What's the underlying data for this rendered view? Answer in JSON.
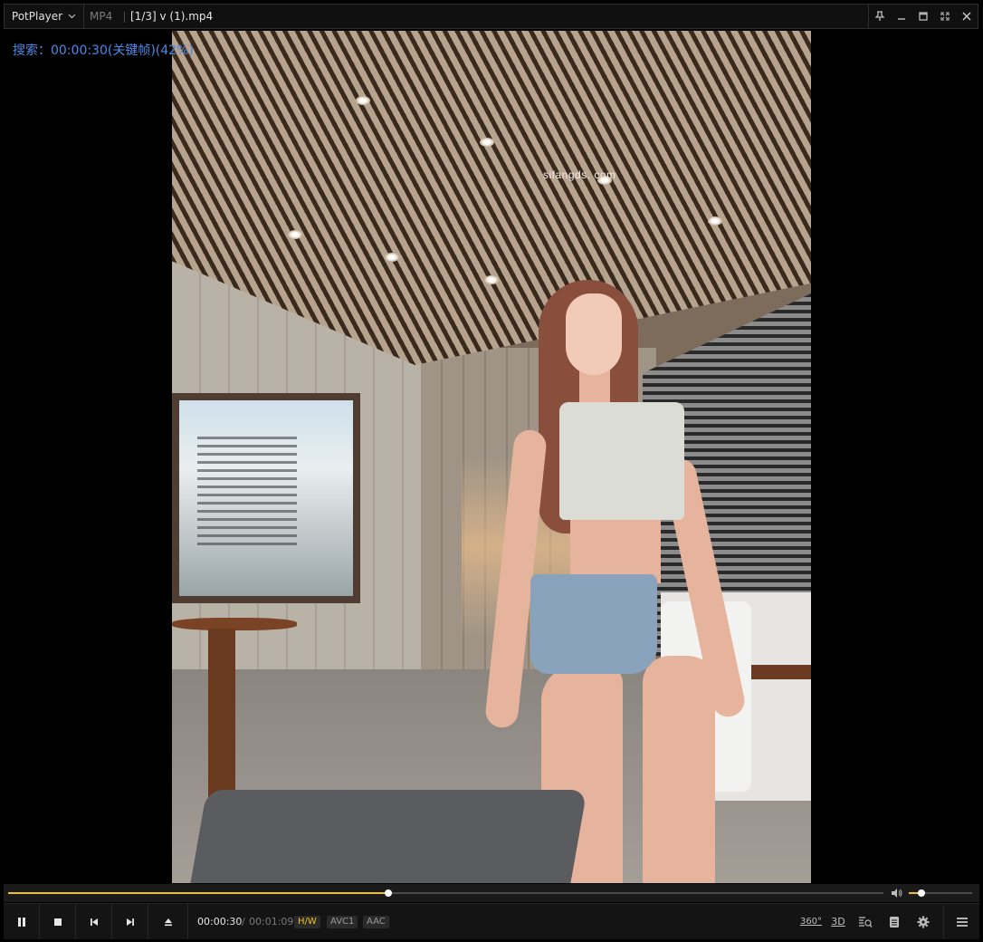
{
  "titlebar": {
    "app_name": "PotPlayer",
    "format": "MP4",
    "file_title": "[1/3] v (1).mp4"
  },
  "osd": {
    "text": "搜索：00:00:30(关键帧)(42%)"
  },
  "video": {
    "watermark": "sifangds. com"
  },
  "playback": {
    "progress_fraction": 0.4348,
    "volume_fraction": 0.2,
    "time_current": "00:00:30",
    "time_separator": "/",
    "time_total": "00:01:09"
  },
  "badges": {
    "hw": "H/W",
    "video_codec": "AVC1",
    "audio_codec": "AAC"
  },
  "right_controls": {
    "vr360_label": "360°",
    "stereo3d_label": "3D"
  },
  "colors": {
    "accent": "#f0c020",
    "osd_text": "#4c88e8",
    "background": "#000000",
    "bar": "#141414"
  },
  "icons": {
    "app_menu": "chevron-down-icon",
    "pin": "pin-icon",
    "minimize": "minimize-icon",
    "maximize": "maximize-icon",
    "fullscreen": "fullscreen-icon",
    "close": "close-icon",
    "pause": "pause-icon",
    "stop": "stop-icon",
    "previous": "previous-icon",
    "next": "next-icon",
    "eject": "eject-icon",
    "volume": "volume-icon",
    "search": "search-list-icon",
    "playlist": "playlist-icon",
    "settings": "gear-icon",
    "menu": "hamburger-menu-icon"
  }
}
